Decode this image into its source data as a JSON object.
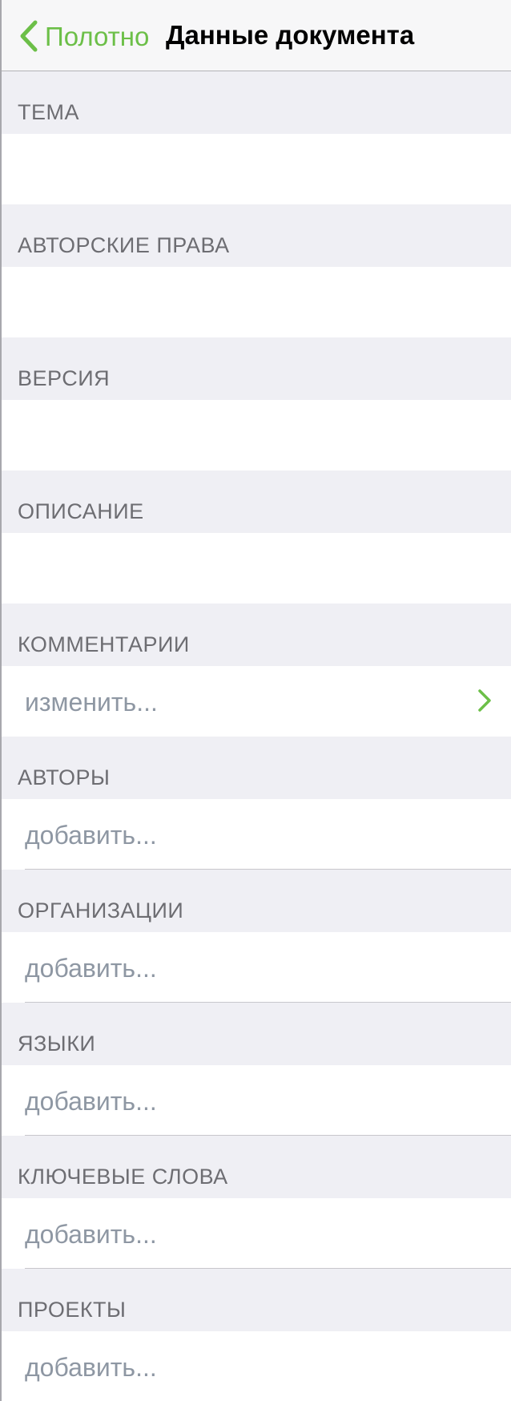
{
  "nav": {
    "back_label": "Полотно",
    "title": "Данные документа",
    "accent_color": "#6cbf48"
  },
  "sections": [
    {
      "header": "ТЕМА",
      "kind": "text",
      "value": ""
    },
    {
      "header": "АВТОРСКИЕ ПРАВА",
      "kind": "text",
      "value": ""
    },
    {
      "header": "ВЕРСИЯ",
      "kind": "text",
      "value": ""
    },
    {
      "header": "ОПИСАНИЕ",
      "kind": "text",
      "value": ""
    },
    {
      "header": "КОММЕНТАРИИ",
      "kind": "link",
      "placeholder": "изменить...",
      "icon": "chevron-right-icon"
    },
    {
      "header": "АВТОРЫ",
      "kind": "add",
      "placeholder": "добавить..."
    },
    {
      "header": "ОРГАНИЗАЦИИ",
      "kind": "add",
      "placeholder": "добавить..."
    },
    {
      "header": "ЯЗЫКИ",
      "kind": "add",
      "placeholder": "добавить..."
    },
    {
      "header": "КЛЮЧЕВЫЕ СЛОВА",
      "kind": "add",
      "placeholder": "добавить..."
    },
    {
      "header": "ПРОЕКТЫ",
      "kind": "add",
      "placeholder": "добавить..."
    }
  ]
}
